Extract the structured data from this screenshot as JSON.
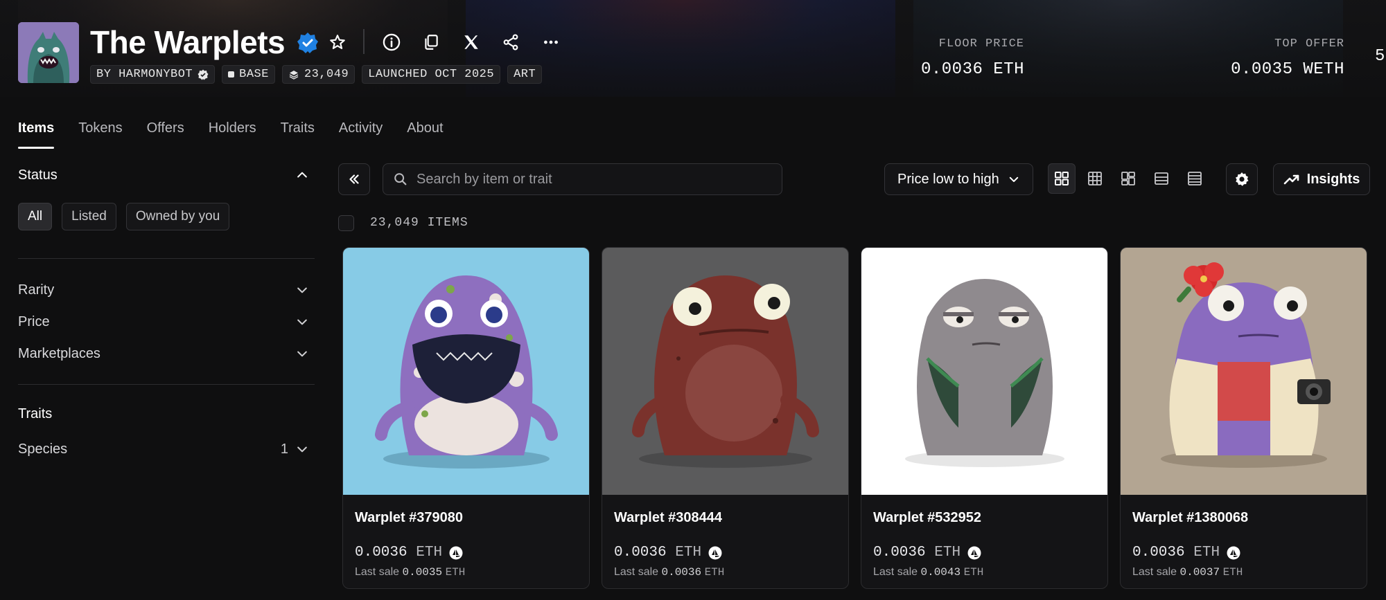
{
  "collection": {
    "name": "The Warplets",
    "chips": {
      "creator": "BY HARMONYBOT",
      "chain": "BASE",
      "supply": "23,049",
      "launched": "LAUNCHED OCT 2025",
      "category": "ART"
    },
    "stats": [
      {
        "label": "FLOOR PRICE",
        "value": "0.0036 ETH"
      },
      {
        "label": "TOP OFFER",
        "value": "0.0035 WETH"
      },
      {
        "label": "",
        "value": "5"
      }
    ]
  },
  "header_icons": [
    "verified-icon",
    "star-icon",
    "info-icon",
    "copy-icon",
    "x-logo-icon",
    "share-icon",
    "more-icon"
  ],
  "tabs": [
    "Items",
    "Tokens",
    "Offers",
    "Holders",
    "Traits",
    "Activity",
    "About"
  ],
  "sidebar": {
    "status": {
      "heading": "Status",
      "options": [
        "All",
        "Listed",
        "Owned by you"
      ],
      "selected": "All"
    },
    "filters": [
      "Rarity",
      "Price",
      "Marketplaces"
    ],
    "traits": {
      "heading": "Traits",
      "items": [
        {
          "label": "Species",
          "count": "1"
        }
      ]
    }
  },
  "toolbar": {
    "search_placeholder": "Search by item or trait",
    "sort_label": "Price low to high",
    "insights_label": "Insights",
    "item_count": "23,049 ITEMS"
  },
  "items": [
    {
      "name": "Warplet #379080",
      "price": "0.0036",
      "unit": "ETH",
      "last_sale_label": "Last sale",
      "last_sale": "0.0035",
      "last_unit": "ETH",
      "bg": "#87cbe6"
    },
    {
      "name": "Warplet #308444",
      "price": "0.0036",
      "unit": "ETH",
      "last_sale_label": "Last sale",
      "last_sale": "0.0036",
      "last_unit": "ETH",
      "bg": "#5b5b5c"
    },
    {
      "name": "Warplet #532952",
      "price": "0.0036",
      "unit": "ETH",
      "last_sale_label": "Last sale",
      "last_sale": "0.0043",
      "last_unit": "ETH",
      "bg": "#ffffff"
    },
    {
      "name": "Warplet #1380068",
      "price": "0.0036",
      "unit": "ETH",
      "last_sale_label": "Last sale",
      "last_sale": "0.0037",
      "last_unit": "ETH",
      "bg": "#b3a592"
    }
  ],
  "colors": {
    "background": "#0f0f10",
    "verified": "#2081e2",
    "accent_text": "#ffffff"
  }
}
